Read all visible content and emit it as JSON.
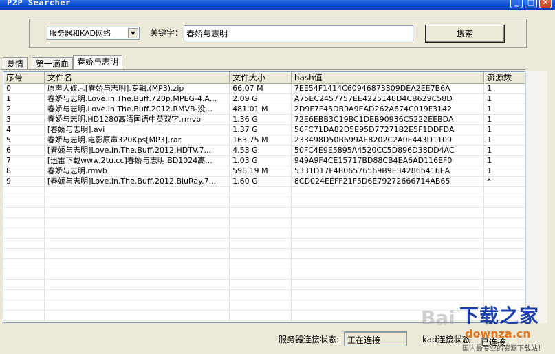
{
  "window": {
    "title": "P2P Searcher",
    "buttons": {
      "minimize": "_",
      "maximize": "□",
      "close": "✕"
    }
  },
  "search": {
    "network_selected": "服务器和KAD网络",
    "keyword_label": "关键字：",
    "keyword_value": "春娇与志明",
    "search_button": "搜索"
  },
  "tabs": [
    {
      "label": "爱情"
    },
    {
      "label": "第一滴血"
    },
    {
      "label": "春娇与志明"
    }
  ],
  "table": {
    "headers": [
      "序号",
      "文件名",
      "文件大小",
      "hash值",
      "资源数"
    ],
    "rows": [
      [
        "0",
        "原声大碟.-.[春娇与志明].专辑.(MP3).zip",
        "66.07 M",
        "7EE54F1414C60946873309DEA2EE7B6A",
        "1"
      ],
      [
        "1",
        "春娇与志明.Love.in.The.Buff.720p.MPEG-4.A...",
        "2.09 G",
        "A75EC2457757EE4225148D4CB629C58D",
        "1"
      ],
      [
        "2",
        "春娇与志明.Love.in.The.Buff.2012.RMVB-没...",
        "481.01 M",
        "2D9F7F45DB0A9EAD262A674C019F3142",
        "1"
      ],
      [
        "3",
        "春娇与志明.HD1280高清国语中英双字.rmvb",
        "1.36 G",
        "72E6EBB3C19BC1DEB90936C5222EEBDA",
        "1"
      ],
      [
        "4",
        "[春娇与志明].avi",
        "1.37 G",
        "56FC71DA82D5E95D77271B2E5F1DDFDA",
        "1"
      ],
      [
        "5",
        "春娇与志明.电影原声320Kps[MP3].rar",
        "163.75 M",
        "233498D50B699AE8202C2A0E443D1109",
        "1"
      ],
      [
        "6",
        "[春娇与志明]Love.in.The.Buff.2012.HDTV.7...",
        "4.53 G",
        "50FC4E9E5895A4520CC5D896D38DD4AC",
        "1"
      ],
      [
        "7",
        "[迅雷下载www.2tu.cc]春娇与志明.BD1024高...",
        "1.03 G",
        "949A9F4CE15717BD88CB4EA6AD116EF0",
        "1"
      ],
      [
        "8",
        "春娇与志明.rmvb",
        "598.19 M",
        "5331D17F4B06576569B9E342866416EA",
        "1"
      ],
      [
        "9",
        "[春娇与志明]Love.in.The.Buff.2012.BluRay.7...",
        "1.60 G",
        "8CD024EEFF21F5D6E79272666714AB65",
        "*"
      ]
    ],
    "empty_rows": 13
  },
  "status": {
    "server_label": "服务器连接状态:",
    "server_value": "正在连接",
    "kad_label": "kad连接状态",
    "kad_value": "已连接"
  },
  "watermark": {
    "baidu": "Bai",
    "logo": "下载之家",
    "url": "downza.cn",
    "slogan": "国内最专业的资源下载站！"
  }
}
